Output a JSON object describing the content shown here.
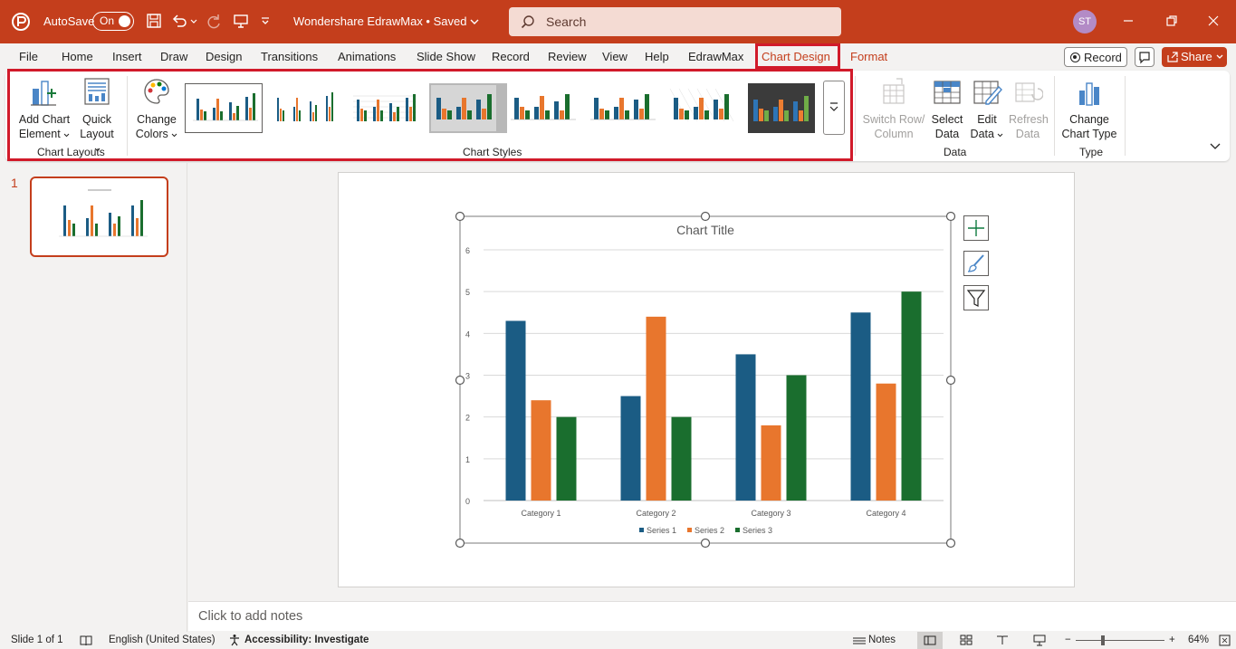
{
  "titlebar": {
    "autosave_label": "AutoSave",
    "autosave_state": "On",
    "doc_title": "Wondershare EdrawMax • Saved",
    "search_placeholder": "Search",
    "user_initials": "ST"
  },
  "menu": {
    "tabs": [
      "File",
      "Home",
      "Insert",
      "Draw",
      "Design",
      "Transitions",
      "Animations",
      "Slide Show",
      "Record",
      "Review",
      "View",
      "Help",
      "EdrawMax",
      "Chart Design",
      "Format"
    ],
    "active": "Chart Design",
    "record_label": "Record",
    "share_label": "Share"
  },
  "ribbon": {
    "add_chart_element": [
      "Add Chart",
      "Element"
    ],
    "quick_layout": [
      "Quick",
      "Layout"
    ],
    "change_colors": [
      "Change",
      "Colors"
    ],
    "switch_row_column": [
      "Switch Row/",
      "Column"
    ],
    "select_data": [
      "Select",
      "Data"
    ],
    "edit_data": [
      "Edit",
      "Data"
    ],
    "refresh_data": [
      "Refresh",
      "Data"
    ],
    "change_chart_type": [
      "Change",
      "Chart Type"
    ],
    "groups": {
      "chart_layouts": "Chart Layouts",
      "chart_styles": "Chart Styles",
      "data": "Data",
      "type": "Type"
    }
  },
  "slides_pane": {
    "slide_number": "1"
  },
  "notes": {
    "placeholder": "Click to add notes"
  },
  "status": {
    "slide_count": "Slide 1 of 1",
    "language": "English (United States)",
    "accessibility": "Accessibility: Investigate",
    "notes_label": "Notes",
    "zoom": "64%"
  },
  "colors": {
    "accent": "#c43e1c",
    "highlight": "#d11a2a",
    "series1": "#1b5c84",
    "series2": "#e8762d",
    "series3": "#1a6e2e"
  },
  "chart_data": {
    "type": "bar",
    "title": "Chart Title",
    "categories": [
      "Category 1",
      "Category 2",
      "Category 3",
      "Category 4"
    ],
    "series": [
      {
        "name": "Series 1",
        "values": [
          4.3,
          2.5,
          3.5,
          4.5
        ]
      },
      {
        "name": "Series 2",
        "values": [
          2.4,
          4.4,
          1.8,
          2.8
        ]
      },
      {
        "name": "Series 3",
        "values": [
          2,
          2,
          3,
          5
        ]
      }
    ],
    "ylim": [
      0,
      6
    ],
    "yticks": [
      "0",
      "1",
      "2",
      "3",
      "4",
      "5",
      "6"
    ],
    "grid": true,
    "legend": "bottom"
  }
}
